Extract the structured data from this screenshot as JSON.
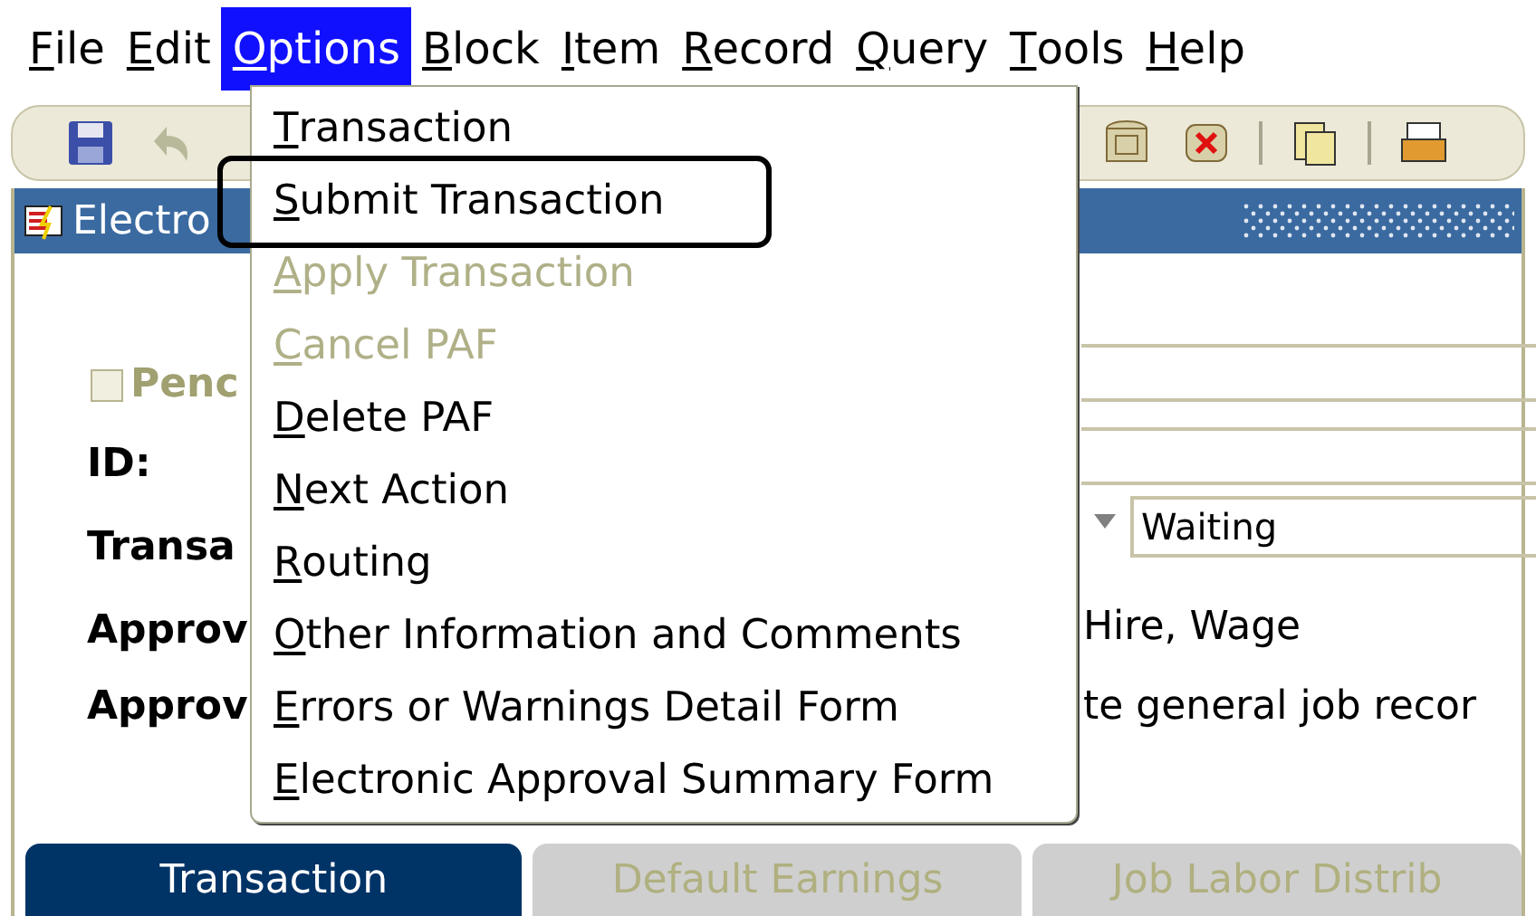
{
  "menu_bar": [
    {
      "label": "File",
      "selected": false
    },
    {
      "label": "Edit",
      "selected": false
    },
    {
      "label": "Options",
      "selected": true
    },
    {
      "label": "Block",
      "selected": false
    },
    {
      "label": "Item",
      "selected": false
    },
    {
      "label": "Record",
      "selected": false
    },
    {
      "label": "Query",
      "selected": false
    },
    {
      "label": "Tools",
      "selected": false
    },
    {
      "label": "Help",
      "selected": false
    }
  ],
  "options_menu": [
    {
      "label": "Transaction",
      "disabled": false,
      "highlighted": false
    },
    {
      "label": "Submit Transaction",
      "disabled": false,
      "highlighted": true
    },
    {
      "label": "Apply Transaction",
      "disabled": true,
      "highlighted": false
    },
    {
      "label": "Cancel PAF",
      "disabled": true,
      "highlighted": false
    },
    {
      "label": "Delete PAF",
      "disabled": false,
      "highlighted": false
    },
    {
      "label": "Next Action",
      "disabled": false,
      "highlighted": false
    },
    {
      "label": "Routing",
      "disabled": false,
      "highlighted": false
    },
    {
      "label": "Other Information and Comments",
      "disabled": false,
      "highlighted": false
    },
    {
      "label": "Errors or Warnings Detail Form",
      "disabled": false,
      "highlighted": false
    },
    {
      "label": "Electronic Approval Summary Form",
      "disabled": false,
      "highlighted": false
    }
  ],
  "window": {
    "title": "Electro"
  },
  "form": {
    "pending": {
      "label": "Penc",
      "checked": false
    },
    "id_label": "ID:",
    "transaction_label": "Transa",
    "status_value": "Waiting",
    "approval_label_1": "Approv",
    "approval_value_1": "Hire, Wage",
    "approval_label_2": "Approv",
    "approval_value_2": "te general job recor"
  },
  "tabs": [
    {
      "label": "Transaction",
      "selected": true
    },
    {
      "label": "Default Earnings",
      "selected": false
    },
    {
      "label": "Job Labor Distrib",
      "selected": false
    }
  ]
}
